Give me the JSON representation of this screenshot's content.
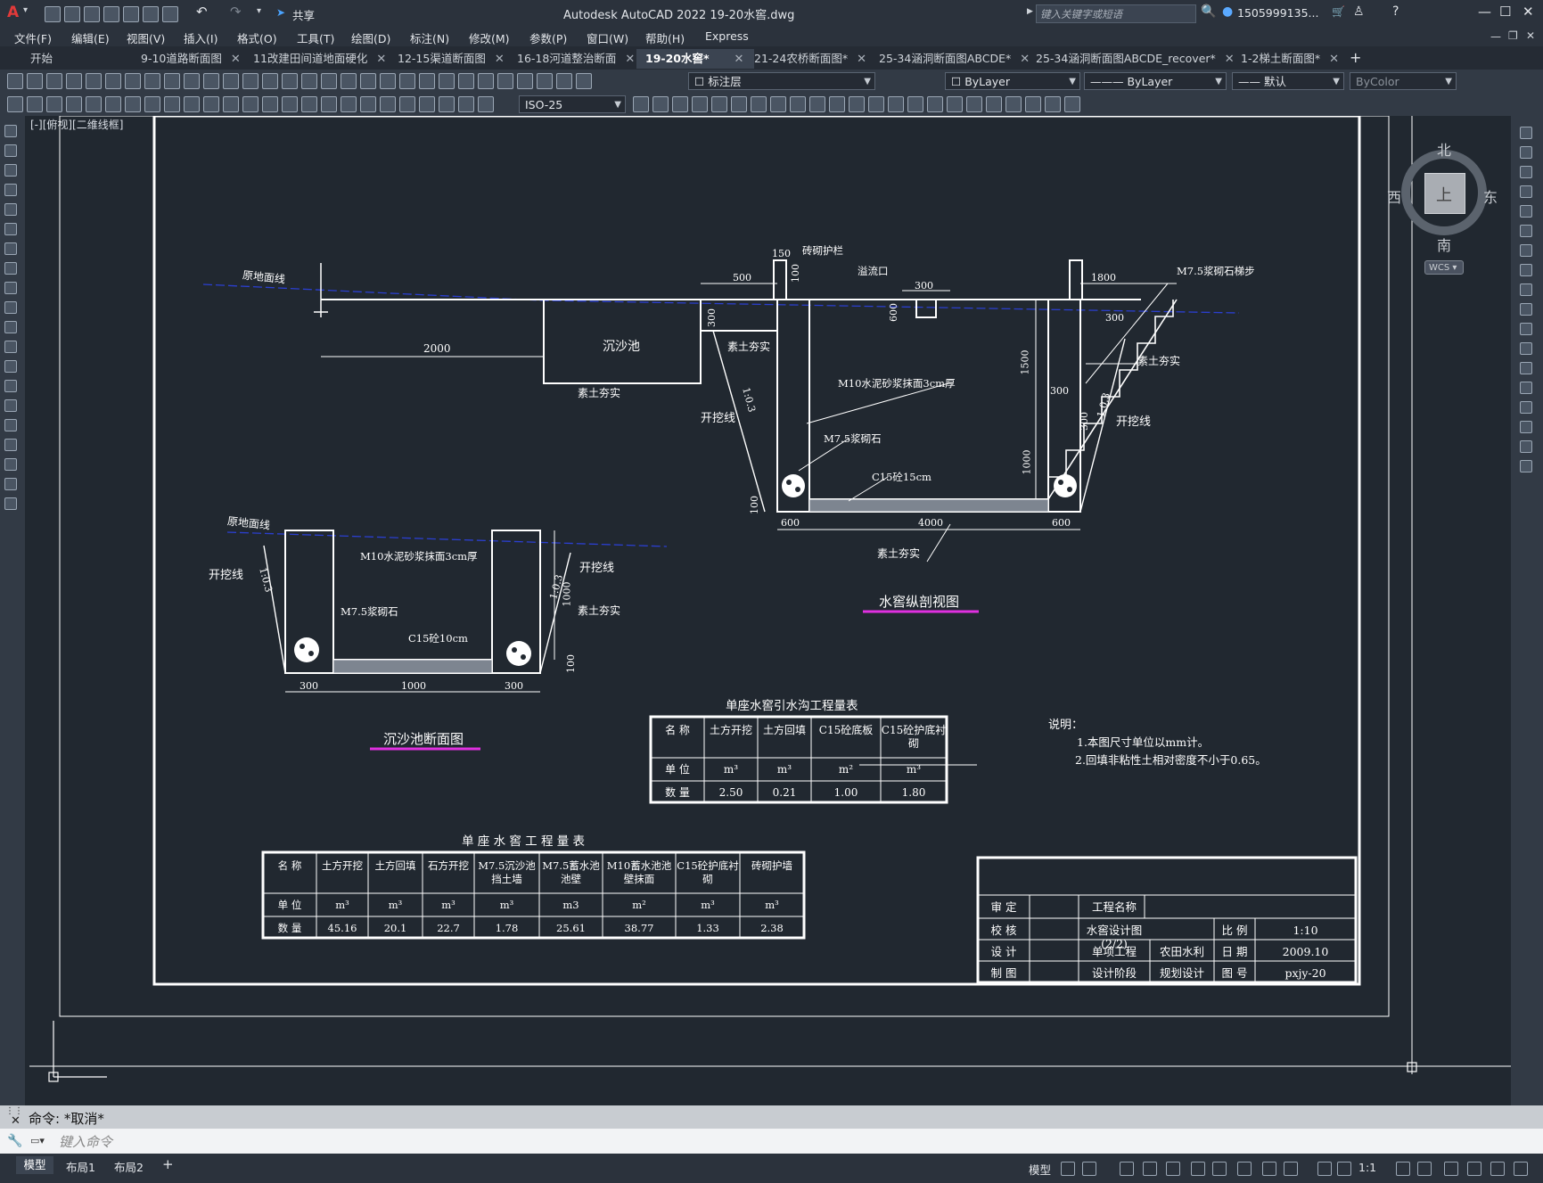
{
  "window": {
    "title": "Autodesk AutoCAD 2022    19-20水窖.dwg",
    "app_letter": "A",
    "share_label": "共享",
    "search_placeholder": "键入关键字或短语",
    "user_label": "1505999135...",
    "controls": [
      "—",
      "☐",
      "✕"
    ]
  },
  "menu": [
    "文件(F)",
    "编辑(E)",
    "视图(V)",
    "插入(I)",
    "格式(O)",
    "工具(T)",
    "绘图(D)",
    "标注(N)",
    "修改(M)",
    "参数(P)",
    "窗口(W)",
    "帮助(H)",
    "Express"
  ],
  "tabs": [
    {
      "label": "开始"
    },
    {
      "label": "9-10道路断面图",
      "close": "✕"
    },
    {
      "label": "11改建田间道地面硬化",
      "close": "✕"
    },
    {
      "label": "12-15渠道断面图",
      "close": "✕"
    },
    {
      "label": "16-18河道整治断面",
      "close": "✕"
    },
    {
      "label": "19-20水窖*",
      "close": "✕",
      "active": true
    },
    {
      "label": "21-24农桥断面图*",
      "close": "✕"
    },
    {
      "label": "25-34涵洞断面图ABCDE*",
      "close": "✕"
    },
    {
      "label": "25-34涵洞断面图ABCDE_recover*",
      "close": "✕"
    },
    {
      "label": "1-2梯土断面图*",
      "close": "✕"
    }
  ],
  "new_tab": "+",
  "toolbar": {
    "layer": "标注层",
    "color": "ByLayer",
    "linetype": "ByLayer",
    "lineweight": "默认",
    "plotstyle": "ByColor",
    "dimstyle": "ISO-25"
  },
  "viewport_label": "[-][俯视][二维线框]",
  "viewcube": {
    "north": "北",
    "south": "南",
    "east": "东",
    "west": "西",
    "top": "上",
    "wcs": "WCS"
  },
  "drawing": {
    "ground_label": "原地面线",
    "ground_label2": "原地面线",
    "settle_pool": "沉沙池",
    "rammed": "素土夯实",
    "excavation": "开挖线",
    "slope": "1:0.3",
    "brick_rail": "砖砌护栏",
    "overflow": "溢流口",
    "stair": "M7.5浆砌石梯步",
    "m10_3cm": "M10水泥砂浆抹面3cm厚",
    "m75": "M7.5浆砌石",
    "c15_15": "C15砼15cm",
    "c15_10": "C15砼10cm",
    "dims_top": [
      "150",
      "500",
      "300",
      "1800",
      "100",
      "300",
      "300",
      "600",
      "1500",
      "1000",
      "300",
      "300",
      "100"
    ],
    "dim_2000": "2000",
    "dims_bottom": [
      "600",
      "4000",
      "600"
    ],
    "dims_sec": [
      "300",
      "1000",
      "300",
      "1000",
      "100"
    ],
    "title_main": "水窖纵剖视图",
    "title_sec": "沉沙池断面图",
    "notes_title": "说明：",
    "notes": [
      "1.本图尺寸单位以mm计。",
      "2.回填非粘性土相对密度不小于0.65。"
    ]
  },
  "table1": {
    "caption": "单座水窖引水沟工程量表",
    "rows": [
      [
        "名  称",
        "土方开挖",
        "土方回填",
        "C15砼底板",
        "C15砼护底衬砌"
      ],
      [
        "单  位",
        "m³",
        "m³",
        "m²",
        "m³"
      ],
      [
        "数  量",
        "2.50",
        "0.21",
        "1.00",
        "1.80"
      ]
    ]
  },
  "table2": {
    "caption": "单 座 水 窖 工 程 量 表",
    "rows": [
      [
        "名  称",
        "土方开挖",
        "土方回填",
        "石方开挖",
        "M7.5沉沙池挡土墙",
        "M7.5蓄水池池壁",
        "M10蓄水池池壁抹面",
        "C15砼护底衬砌",
        "砖砌护墙"
      ],
      [
        "单  位",
        "m³",
        "m³",
        "m³",
        "m³",
        "m3",
        "m²",
        "m³",
        "m³"
      ],
      [
        "数  量",
        "45.16",
        "20.1",
        "22.7",
        "1.78",
        "25.61",
        "38.77",
        "1.33",
        "2.38"
      ]
    ]
  },
  "titleblock": {
    "rows": [
      [
        "审 定",
        "",
        "工程名称",
        "",
        "",
        ""
      ],
      [
        "校 核",
        "",
        "水窖设计图(2/2)",
        "",
        "比 例",
        "1:10"
      ],
      [
        "设 计",
        "",
        "单项工程",
        "农田水利",
        "日 期",
        "2009.10"
      ],
      [
        "制 图",
        "",
        "设计阶段",
        "规划设计",
        "图 号",
        "pxjy-20"
      ]
    ]
  },
  "command": {
    "history": "命令: *取消*",
    "prompt": "键入命令"
  },
  "status": {
    "layout_tabs": [
      "模型",
      "布局1",
      "布局2"
    ],
    "add": "+",
    "model": "模型",
    "scale": "1:1"
  },
  "colors": {
    "accent_magenta": "#e030e0",
    "ground_blue": "#2b3fd0",
    "bg": "#212830"
  }
}
